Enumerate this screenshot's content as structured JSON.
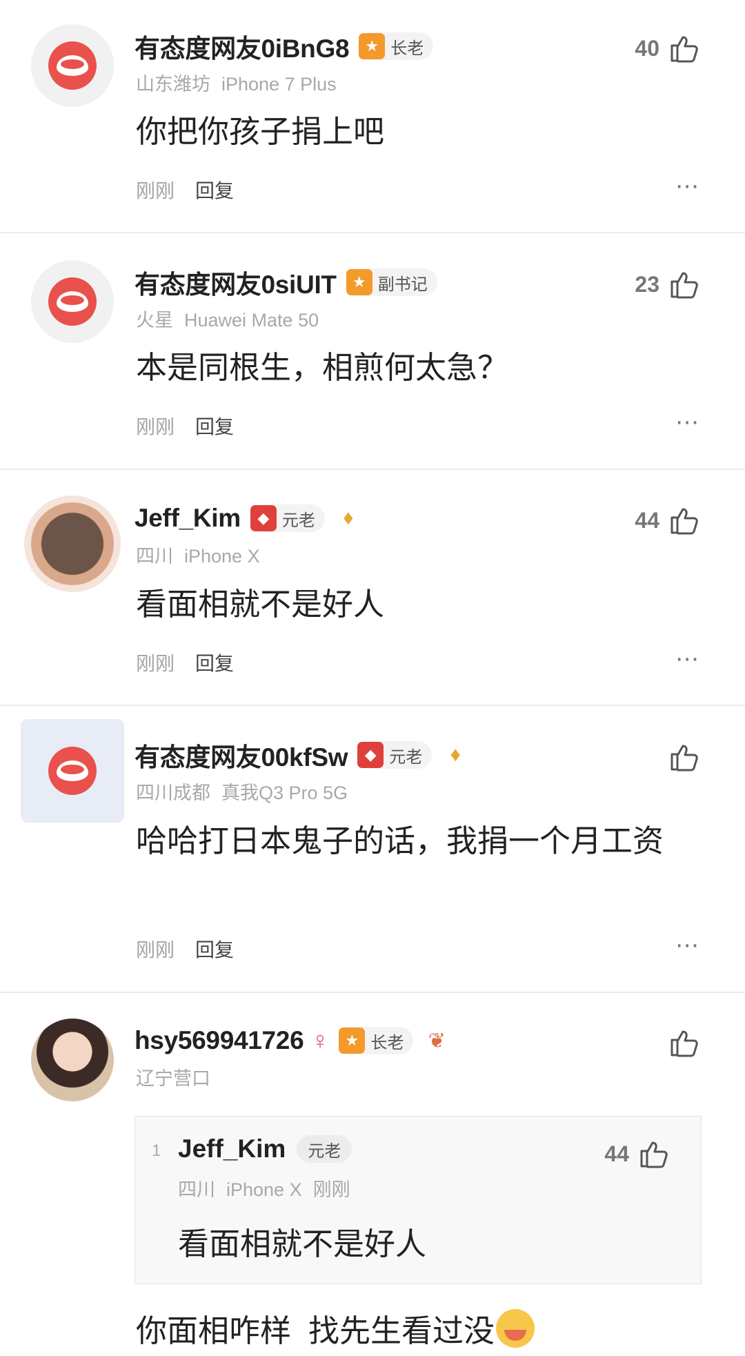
{
  "comments": [
    {
      "name": "有态度网友0iBnG8",
      "badge": "长老",
      "location": "山东潍坊",
      "device": "iPhone 7 Plus",
      "content": "你把你孩子捐上吧",
      "time": "刚刚",
      "reply": "回复",
      "likes": "40"
    },
    {
      "name": "有态度网友0siUIT",
      "badge": "副书记",
      "location": "火星",
      "device": "Huawei Mate 50",
      "content": "本是同根生，相煎何太急？",
      "time": "刚刚",
      "reply": "回复",
      "likes": "23"
    },
    {
      "name": "Jeff_Kim",
      "badge": "元老",
      "location": "四川",
      "device": "iPhone X",
      "content": "看面相就不是好人",
      "time": "刚刚",
      "reply": "回复",
      "likes": "44"
    },
    {
      "name": "有态度网友00kfSw",
      "badge": "元老",
      "location": "四川成都",
      "device": "真我Q3 Pro 5G",
      "content": "哈哈打日本鬼子的话，我捐一个月工资",
      "time": "刚刚",
      "reply": "回复",
      "likes": ""
    },
    {
      "name": "hsy569941726",
      "gender_icon": "♀",
      "badge": "长老",
      "location": "辽宁营口",
      "quote": {
        "index": "1",
        "name": "Jeff_Kim",
        "badge": "元老",
        "location": "四川",
        "device": "iPhone X",
        "time": "刚刚",
        "content": "看面相就不是好人",
        "likes": "44"
      },
      "content": "你面相咋样  找先生看过没"
    }
  ],
  "more_icon": "⋯",
  "colors": {
    "brand_red": "#e9514d",
    "badge_orange": "#f39a2b",
    "badge_red": "#e0403c",
    "meta_gray": "#a8a8a8"
  }
}
